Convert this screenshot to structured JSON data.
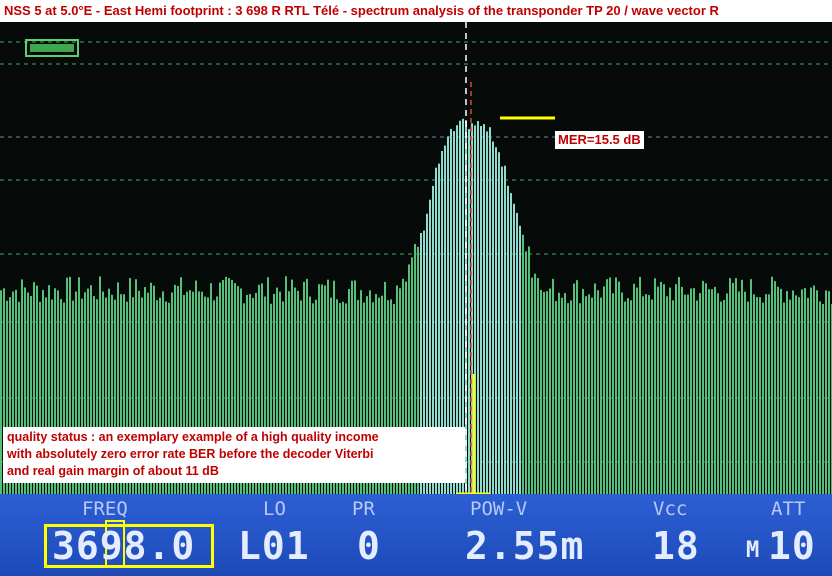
{
  "title": "NSS 5 at 5.0°E - East Hemi footprint : 3 698 R RTL Télé - spectrum analysis of the transponder TP 20 / wave vector R",
  "mer_label": "MER=15.5 dB",
  "quality_note": {
    "line1": "quality status :  an exemplary example of a high quality income",
    "line2": "with absolutely zero error rate BER before the decoder Viterbi",
    "line3": "and real gain  margin of about 11 dB"
  },
  "status": {
    "freq": {
      "label": "FREQ",
      "value": "3698.0"
    },
    "lo": {
      "label": "LO",
      "value": "L01"
    },
    "pr": {
      "label": "PR",
      "value": "0"
    },
    "pow": {
      "label": "POW-V",
      "value": "2.55m"
    },
    "vcc": {
      "label": "Vcc",
      "value": "18"
    },
    "att": {
      "label": "ATT",
      "prefix": "M",
      "value": "10"
    }
  },
  "colors": {
    "spectrum_fill": "#55c07a",
    "spectrum_peak": "#8fdccf",
    "grid_line": "#2f7a47",
    "marker_line": "#ffff00",
    "annotation_text": "#c00000",
    "status_bg": "#2a5cd0"
  },
  "icons": {
    "signal_indicator": "battery-level-icon"
  }
}
